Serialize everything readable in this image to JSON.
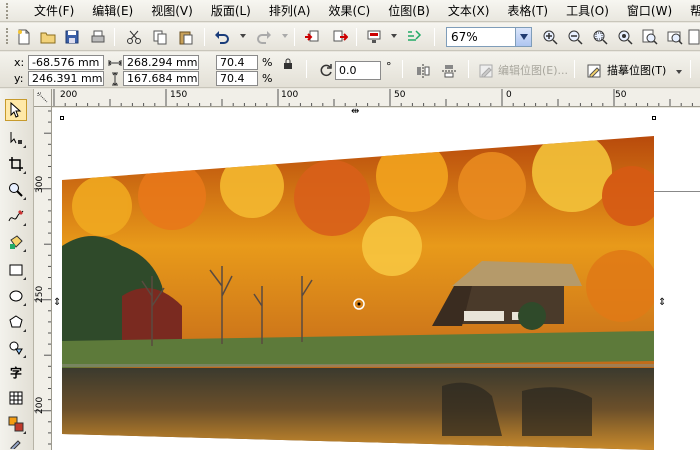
{
  "menu": [
    "文件(F)",
    "编辑(E)",
    "视图(V)",
    "版面(L)",
    "排列(A)",
    "效果(C)",
    "位图(B)",
    "文本(X)",
    "表格(T)",
    "工具(O)",
    "窗口(W)",
    "帮助"
  ],
  "toolbar": {
    "zoom_value": "67%"
  },
  "propbar": {
    "x_label": "x:",
    "y_label": "y:",
    "x_value": "-68.576 mm",
    "y_value": "246.391 mm",
    "width_value": "268.294 mm",
    "height_value": "167.684 mm",
    "scale_x": "70.4",
    "scale_y": "70.4",
    "percent": "%",
    "rotation_value": "0.0",
    "degree": "°",
    "edit_bitmap_label": "编辑位图(E)...",
    "trace_bitmap_label": "描摹位图(T)"
  },
  "rulers": {
    "h_ticks": [
      "200",
      "150",
      "100",
      "50",
      "0",
      "50"
    ],
    "v_ticks": [
      "300",
      "250",
      "200"
    ]
  },
  "toolbox": {
    "text_tool_label": "字"
  },
  "colors": {
    "accent": "#ffe9a8",
    "ui_bg": "#e9e7df",
    "field_border": "#7f9db9"
  }
}
